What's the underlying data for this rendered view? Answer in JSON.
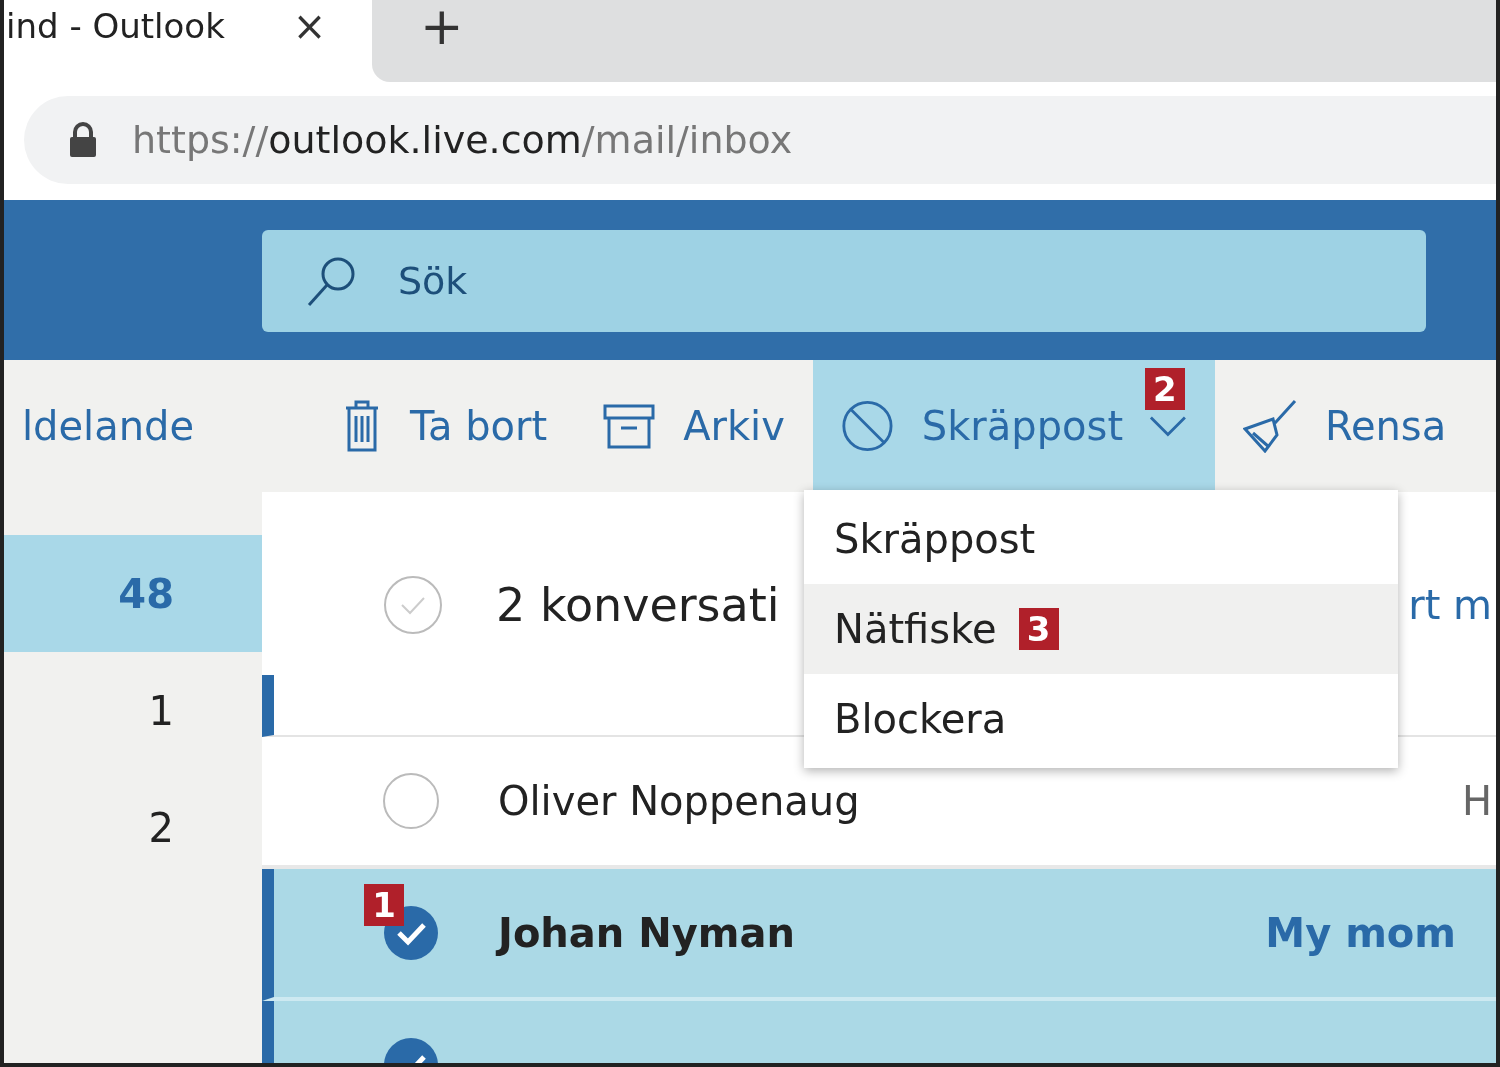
{
  "browser": {
    "tab_title": "ind - Outlook",
    "close": "×",
    "new_tab": "+",
    "url": {
      "scheme": "https://",
      "host": "outlook.live.com",
      "path": "/mail/inbox"
    }
  },
  "search": {
    "placeholder": "Sök"
  },
  "toolbar": {
    "items": [
      {
        "label": "ldelande",
        "kind": "text"
      },
      {
        "label": "Ta bort",
        "kind": "delete"
      },
      {
        "label": "Arkiv",
        "kind": "archive"
      },
      {
        "label": "Skräppost",
        "kind": "junk",
        "expanded": true,
        "badge": "2"
      },
      {
        "label": "Rensa",
        "kind": "sweep"
      }
    ]
  },
  "folders": [
    {
      "count": "48",
      "selected": true
    },
    {
      "count": "1",
      "selected": false
    },
    {
      "count": "2",
      "selected": false
    }
  ],
  "list_header": {
    "title": "2 konversati",
    "right": "rt m",
    "selected": false
  },
  "messages": [
    {
      "sender": "Oliver Noppenaug",
      "preview": "H",
      "selected": false,
      "unread": false
    },
    {
      "sender": "Johan Nyman",
      "subject": "My mom",
      "selected": true,
      "unread": true,
      "badge": "1"
    },
    {
      "selected": true
    }
  ],
  "menu": {
    "items": [
      {
        "label": "Skräppost",
        "hovered": false
      },
      {
        "label": "Nätfiske",
        "hovered": true,
        "badge": "3"
      },
      {
        "label": "Blockera",
        "hovered": false
      }
    ]
  }
}
